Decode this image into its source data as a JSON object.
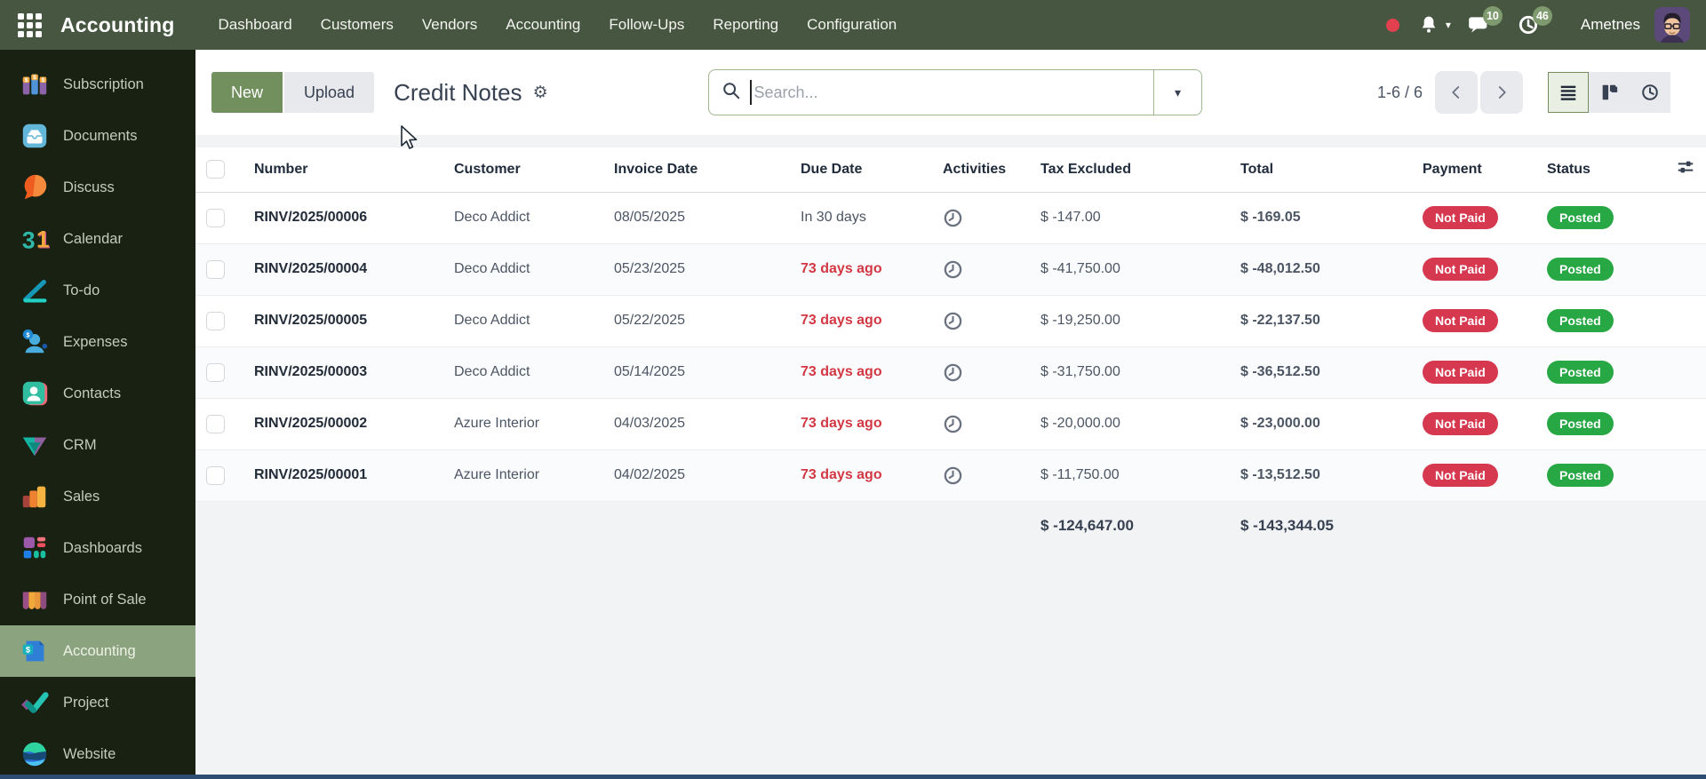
{
  "topbar": {
    "brand": "Accounting",
    "menu": [
      "Dashboard",
      "Customers",
      "Vendors",
      "Accounting",
      "Follow-Ups",
      "Reporting",
      "Configuration"
    ],
    "messages_badge": "10",
    "activities_badge": "46",
    "user_name": "Ametnes"
  },
  "sidebar": {
    "items": [
      {
        "label": "Subscription",
        "active": false
      },
      {
        "label": "Documents",
        "active": false
      },
      {
        "label": "Discuss",
        "active": false
      },
      {
        "label": "Calendar",
        "active": false
      },
      {
        "label": "To-do",
        "active": false
      },
      {
        "label": "Expenses",
        "active": false
      },
      {
        "label": "Contacts",
        "active": false
      },
      {
        "label": "CRM",
        "active": false
      },
      {
        "label": "Sales",
        "active": false
      },
      {
        "label": "Dashboards",
        "active": false
      },
      {
        "label": "Point of Sale",
        "active": false
      },
      {
        "label": "Accounting",
        "active": true
      },
      {
        "label": "Project",
        "active": false
      },
      {
        "label": "Website",
        "active": false
      }
    ]
  },
  "control_panel": {
    "new_label": "New",
    "upload_label": "Upload",
    "title": "Credit Notes",
    "search_placeholder": "Search...",
    "pager": "1-6 / 6"
  },
  "icons": {
    "gear": "⚙",
    "caret_down": "▾"
  },
  "table": {
    "columns": [
      "Number",
      "Customer",
      "Invoice Date",
      "Due Date",
      "Activities",
      "Tax Excluded",
      "Total",
      "Payment",
      "Status"
    ],
    "rows": [
      {
        "number": "RINV/2025/00006",
        "customer": "Deco Addict",
        "invoice_date": "08/05/2025",
        "due_date": "In 30 days",
        "overdue": false,
        "tax_excluded": "$ -147.00",
        "total": "$ -169.05",
        "payment": "Not Paid",
        "status": "Posted"
      },
      {
        "number": "RINV/2025/00004",
        "customer": "Deco Addict",
        "invoice_date": "05/23/2025",
        "due_date": "73 days ago",
        "overdue": true,
        "tax_excluded": "$ -41,750.00",
        "total": "$ -48,012.50",
        "payment": "Not Paid",
        "status": "Posted"
      },
      {
        "number": "RINV/2025/00005",
        "customer": "Deco Addict",
        "invoice_date": "05/22/2025",
        "due_date": "73 days ago",
        "overdue": true,
        "tax_excluded": "$ -19,250.00",
        "total": "$ -22,137.50",
        "payment": "Not Paid",
        "status": "Posted"
      },
      {
        "number": "RINV/2025/00003",
        "customer": "Deco Addict",
        "invoice_date": "05/14/2025",
        "due_date": "73 days ago",
        "overdue": true,
        "tax_excluded": "$ -31,750.00",
        "total": "$ -36,512.50",
        "payment": "Not Paid",
        "status": "Posted"
      },
      {
        "number": "RINV/2025/00002",
        "customer": "Azure Interior",
        "invoice_date": "04/03/2025",
        "due_date": "73 days ago",
        "overdue": true,
        "tax_excluded": "$ -20,000.00",
        "total": "$ -23,000.00",
        "payment": "Not Paid",
        "status": "Posted"
      },
      {
        "number": "RINV/2025/00001",
        "customer": "Azure Interior",
        "invoice_date": "04/02/2025",
        "due_date": "73 days ago",
        "overdue": true,
        "tax_excluded": "$ -11,750.00",
        "total": "$ -13,512.50",
        "payment": "Not Paid",
        "status": "Posted"
      }
    ],
    "totals": {
      "tax_excluded": "$ -124,647.00",
      "total": "$ -143,344.05"
    }
  },
  "colors": {
    "topbar_bg": "#475640",
    "sidebar_bg": "#182112",
    "active_sidebar_item_bg": "#8ba37f",
    "primary_button_green": "#71905e",
    "not_paid_badge_red": "#d6394f",
    "posted_badge_green": "#28a745",
    "overdue_text_red": "#d23844",
    "bottom_bar_blue": "#2d4e72"
  }
}
